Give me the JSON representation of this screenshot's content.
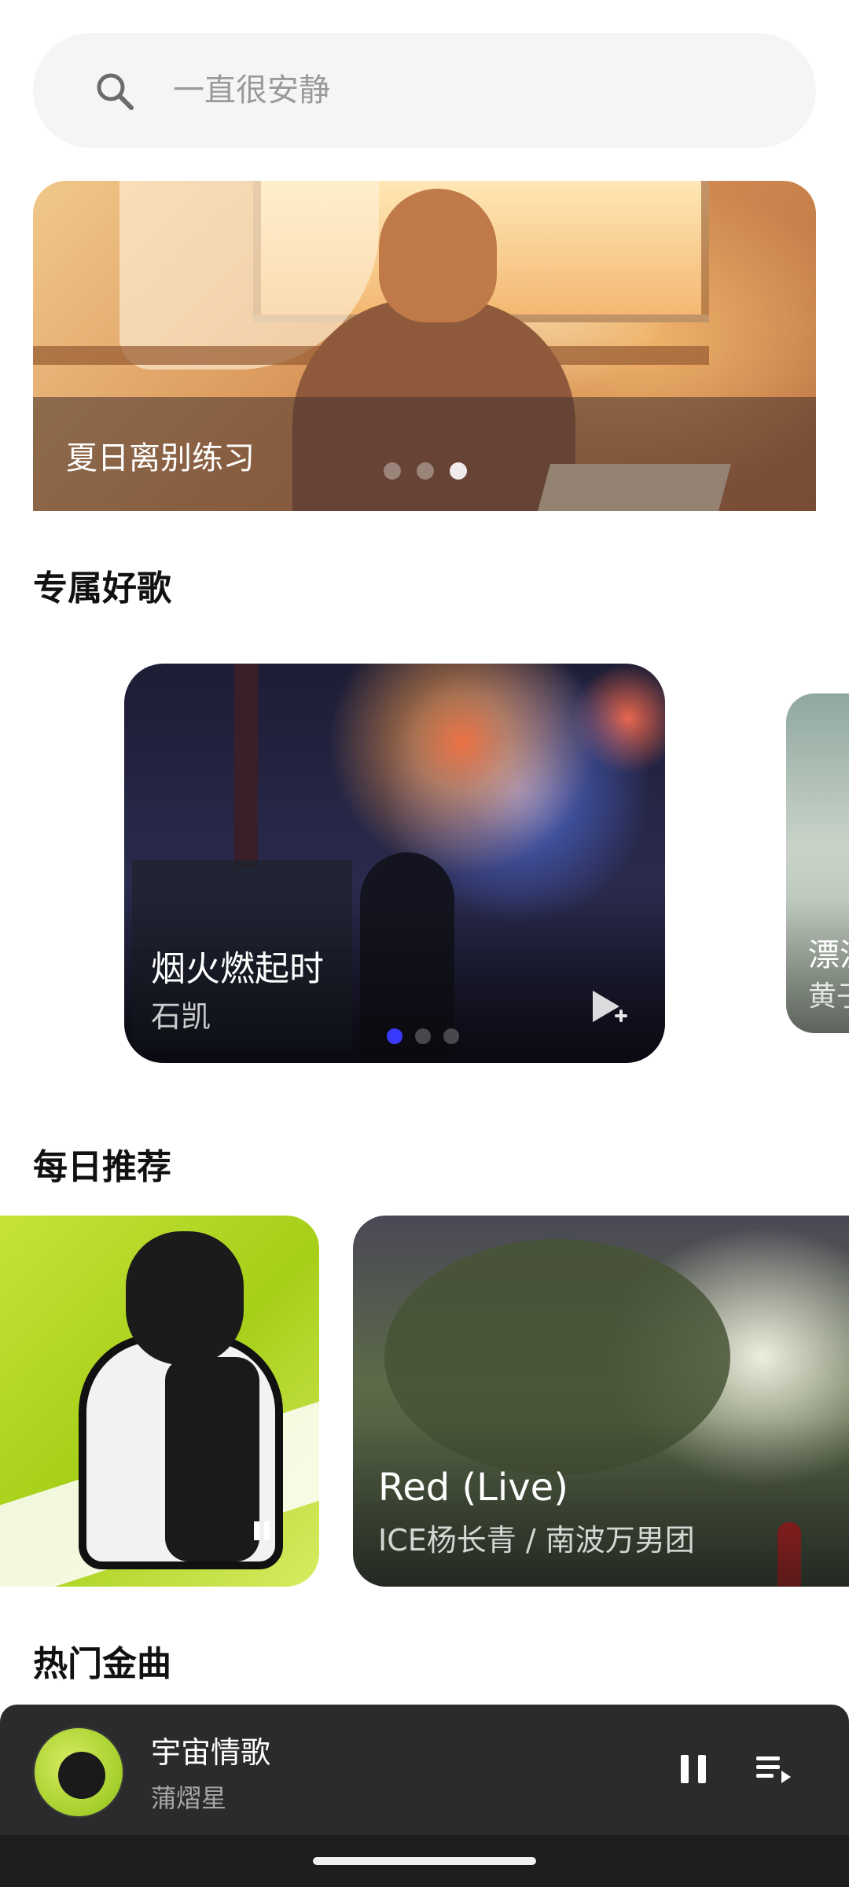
{
  "search": {
    "placeholder": "一直很安静"
  },
  "banner": {
    "title": "夏日离别练习",
    "page_count": 3,
    "active_index": 2
  },
  "sections": {
    "exclusive": {
      "title": "专属好歌"
    },
    "daily": {
      "title": "每日推荐"
    },
    "hot": {
      "title": "热门金曲"
    }
  },
  "exclusive_cards": [
    {
      "song": "烟火燃起时",
      "artist": "石凯",
      "page_count": 3,
      "active_index": 0
    },
    {
      "song": "漂流",
      "artist": "黄子"
    }
  ],
  "daily_cards": [
    {
      "song": "",
      "artist": "",
      "state": "playing"
    },
    {
      "song": "Red (Live)",
      "artist": "ICE杨长青 / 南波万男团"
    }
  ],
  "now_playing": {
    "song": "宇宙情歌",
    "artist": "蒲熠星",
    "state": "playing"
  },
  "icons": {
    "search": "search-icon",
    "play_add": "play-add-icon",
    "pause": "pause-icon",
    "queue": "queue-icon"
  },
  "colors": {
    "player_bg": "#2b2b2d",
    "search_bg": "#f4f5f7",
    "active_dot": "#3a3aff"
  }
}
